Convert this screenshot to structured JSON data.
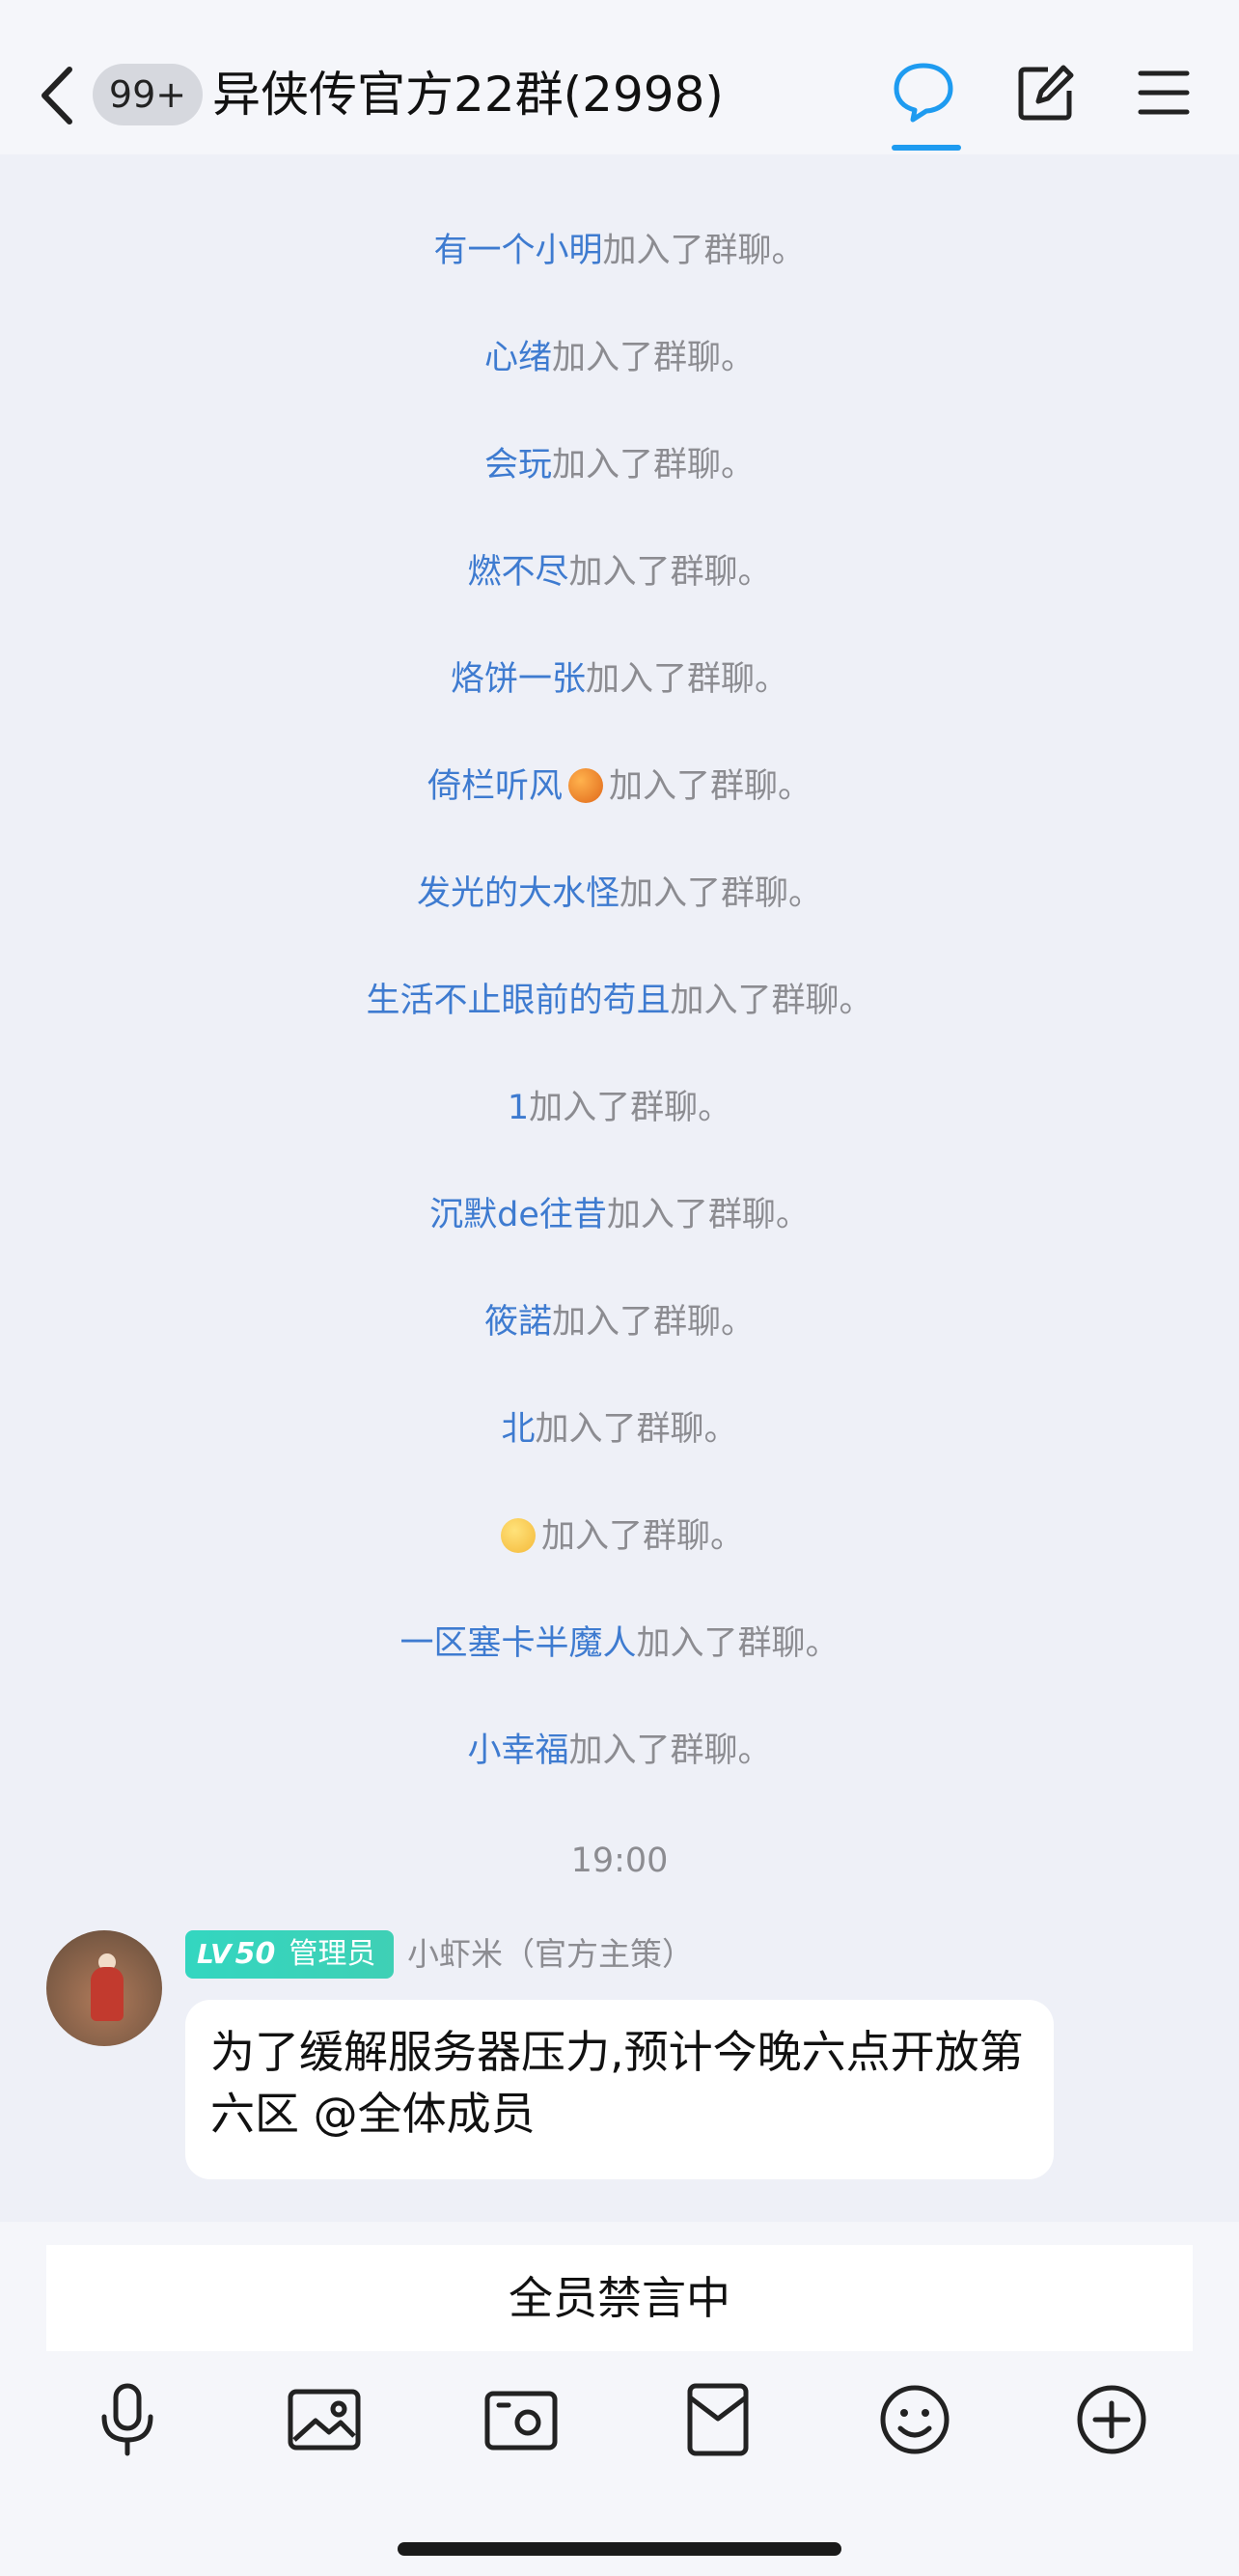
{
  "header": {
    "back_icon": "chevron-left-icon",
    "unread_badge": "99+",
    "title": "异侠传官方22群(2998)",
    "chat_icon": "chat-bubble-icon",
    "edit_icon": "edit-icon",
    "menu_icon": "menu-icon",
    "accent_color": "#1e9bf0"
  },
  "system_messages": [
    {
      "name": "有一个小明",
      "emoji": "",
      "suffix": "加入了群聊。"
    },
    {
      "name": "心绪",
      "emoji": "",
      "suffix": "加入了群聊。"
    },
    {
      "name": "会玩",
      "emoji": "",
      "suffix": "加入了群聊。"
    },
    {
      "name": "燃不尽",
      "emoji": "",
      "suffix": "加入了群聊。"
    },
    {
      "name": "烙饼一张",
      "emoji": "",
      "suffix": "加入了群聊。"
    },
    {
      "name": "倚栏听风",
      "emoji": "orange",
      "suffix": "加入了群聊。"
    },
    {
      "name": "发光的大水怪",
      "emoji": "",
      "suffix": "加入了群聊。"
    },
    {
      "name": "生活不止眼前的苟且",
      "emoji": "",
      "suffix": "加入了群聊。"
    },
    {
      "name": "1",
      "emoji": "",
      "suffix": "加入了群聊。"
    },
    {
      "name": "沉默de往昔",
      "emoji": "",
      "suffix": "加入了群聊。"
    },
    {
      "name": "筱諾",
      "emoji": "",
      "suffix": "加入了群聊。"
    },
    {
      "name": "北",
      "emoji": "",
      "suffix": "加入了群聊。"
    },
    {
      "name": "",
      "emoji": "sleepy",
      "suffix": "加入了群聊。"
    },
    {
      "name": "一区塞卡半魔人",
      "emoji": "",
      "suffix": "加入了群聊。"
    },
    {
      "name": "小幸福",
      "emoji": "",
      "suffix": "加入了群聊。"
    }
  ],
  "time_label": "19:00",
  "message": {
    "level_prefix": "LV",
    "level": "50",
    "role": "管理员",
    "sender": "小虾米（官方主策）",
    "text": "为了缓解服务器压力,预计今晚六点开放第六区 @全体成员"
  },
  "input": {
    "mute_label": "全员禁言中",
    "tools": [
      "microphone-icon",
      "image-icon",
      "camera-icon",
      "red-packet-icon",
      "emoji-icon",
      "plus-icon"
    ]
  }
}
